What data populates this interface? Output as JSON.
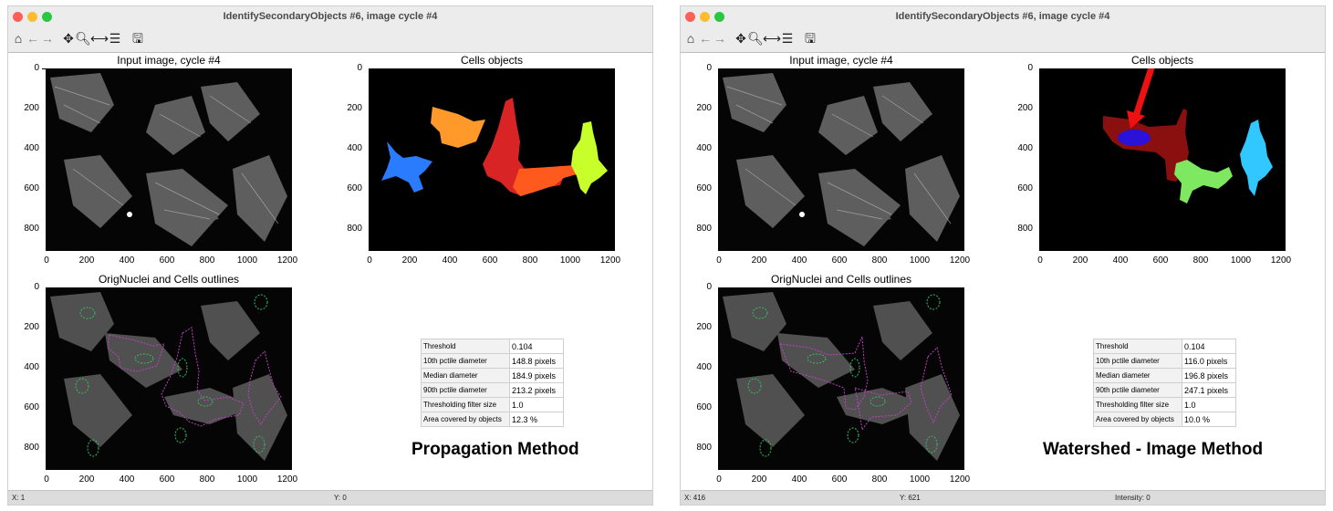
{
  "windows": [
    {
      "title": "IdentifySecondaryObjects #6, image cycle #4",
      "panel_titles": {
        "input": "Input image, cycle #4",
        "cells": "Cells objects",
        "outlines": "OrigNuclei and Cells outlines"
      },
      "method_label": "Propagation Method",
      "measurements": [
        {
          "label": "Threshold",
          "value": "0.104"
        },
        {
          "label": "10th pctile diameter",
          "value": "148.8 pixels"
        },
        {
          "label": "Median diameter",
          "value": "184.9 pixels"
        },
        {
          "label": "90th pctile diameter",
          "value": "213.2 pixels"
        },
        {
          "label": "Thresholding filter size",
          "value": "1.0"
        },
        {
          "label": "Area covered by objects",
          "value": "12.3 %"
        }
      ],
      "status": {
        "x": "X: 1",
        "y": "Y: 0",
        "intensity": ""
      }
    },
    {
      "title": "IdentifySecondaryObjects #6, image cycle #4",
      "panel_titles": {
        "input": "Input image, cycle #4",
        "cells": "Cells objects",
        "outlines": "OrigNuclei and Cells outlines"
      },
      "method_label": "Watershed - Image Method",
      "measurements": [
        {
          "label": "Threshold",
          "value": "0.104"
        },
        {
          "label": "10th pctile diameter",
          "value": "116.0 pixels"
        },
        {
          "label": "Median diameter",
          "value": "196.8 pixels"
        },
        {
          "label": "90th pctile diameter",
          "value": "247.1 pixels"
        },
        {
          "label": "Thresholding filter size",
          "value": "1.0"
        },
        {
          "label": "Area covered by objects",
          "value": "10.0 %"
        }
      ],
      "status": {
        "x": "X: 416",
        "y": "Y: 621",
        "intensity": "Intensity: 0"
      }
    }
  ],
  "axis_ticks": {
    "x": [
      "0",
      "200",
      "400",
      "600",
      "800",
      "1000",
      "1200"
    ],
    "y": [
      "0",
      "200",
      "400",
      "600",
      "800"
    ]
  },
  "toolbar_icons": [
    "home-icon",
    "back-arrow-icon",
    "forward-arrow-icon",
    "pan-icon",
    "zoom-icon",
    "subplots-icon",
    "configure-icon",
    "save-icon"
  ],
  "colors": {
    "window_chrome": "#ececec",
    "image_background": "#050505",
    "cell_outline": "#c040c0",
    "nucleus_outline": "#30c060",
    "annotation_arrow": "#ee1111"
  }
}
